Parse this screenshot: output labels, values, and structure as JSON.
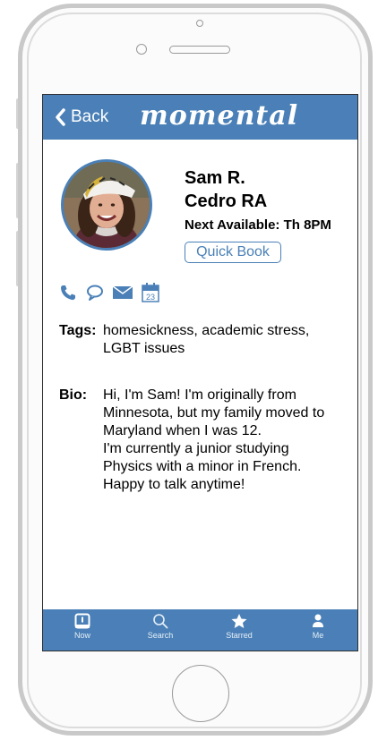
{
  "nav": {
    "back_label": "Back",
    "brand": "momental"
  },
  "profile": {
    "name_line1": "Sam R.",
    "name_line2": "Cedro RA",
    "next_available": "Next Available: Th 8PM",
    "quick_book_label": "Quick Book"
  },
  "contact_icons": [
    "phone-icon",
    "chat-bubble-icon",
    "mail-icon",
    "calendar-icon"
  ],
  "calendar_day": "23",
  "tags": {
    "label": "Tags:",
    "value": [
      "homesickness, academic stress,",
      "LGBT issues"
    ]
  },
  "bio": {
    "label": "Bio:",
    "lines": [
      "Hi, I'm Sam! I'm originally from",
      "Minnesota, but my family moved to",
      "Maryland when I was 12.",
      "I'm currently a junior studying",
      "Physics with a minor in French.",
      "Happy to talk anytime!"
    ]
  },
  "tabs": [
    {
      "label": "Now",
      "icon": "now-icon"
    },
    {
      "label": "Search",
      "icon": "search-icon"
    },
    {
      "label": "Starred",
      "icon": "star-icon"
    },
    {
      "label": "Me",
      "icon": "person-icon"
    }
  ],
  "colors": {
    "accent": "#4a80b7",
    "frame": "#c9c9c9"
  }
}
